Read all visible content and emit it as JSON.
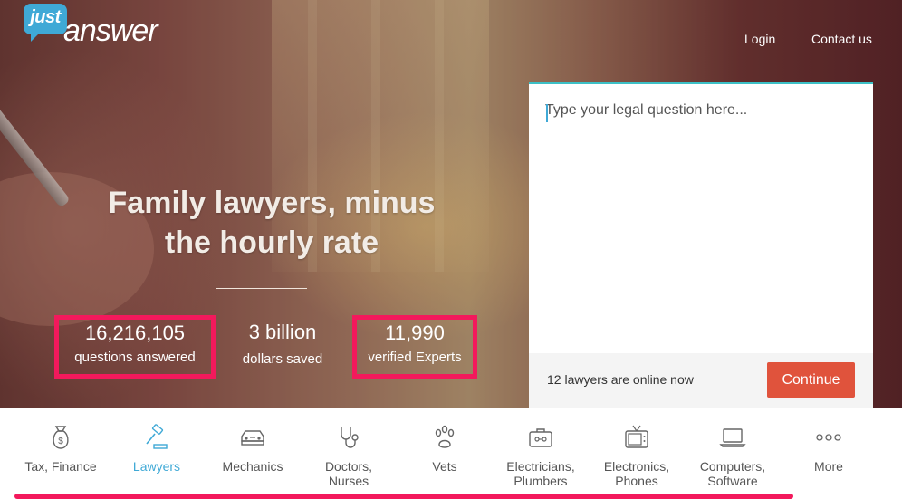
{
  "brand": {
    "logo_top": "just",
    "logo_main": "answer"
  },
  "nav": {
    "login": "Login",
    "contact": "Contact us"
  },
  "hero": {
    "headline_line1": "Family lawyers, minus",
    "headline_line2": "the hourly rate"
  },
  "stats": [
    {
      "value": "16,216,105",
      "label": "questions answered"
    },
    {
      "value": "3 billion",
      "label": "dollars saved"
    },
    {
      "value": "11,990",
      "label": "verified Experts"
    }
  ],
  "question_panel": {
    "placeholder": "Type your legal question here...",
    "online_text": "12 lawyers are online now",
    "continue_label": "Continue"
  },
  "categories": [
    {
      "line1": "Tax, Finance",
      "line2": "",
      "icon": "money-bag-icon"
    },
    {
      "line1": "Lawyers",
      "line2": "",
      "icon": "gavel-icon"
    },
    {
      "line1": "Mechanics",
      "line2": "",
      "icon": "car-icon"
    },
    {
      "line1": "Doctors,",
      "line2": "Nurses",
      "icon": "stethoscope-icon"
    },
    {
      "line1": "Vets",
      "line2": "",
      "icon": "paw-icon"
    },
    {
      "line1": "Electricians,",
      "line2": "Plumbers",
      "icon": "toolbox-icon"
    },
    {
      "line1": "Electronics,",
      "line2": "Phones",
      "icon": "tv-icon"
    },
    {
      "line1": "Computers,",
      "line2": "Software",
      "icon": "laptop-icon"
    },
    {
      "line1": "More",
      "line2": "",
      "icon": "more-dots-icon"
    }
  ],
  "colors": {
    "highlight": "#f3195c",
    "accent": "#3fa9d6",
    "panel_top": "#3cc0c6",
    "cta": "#e0533c"
  }
}
